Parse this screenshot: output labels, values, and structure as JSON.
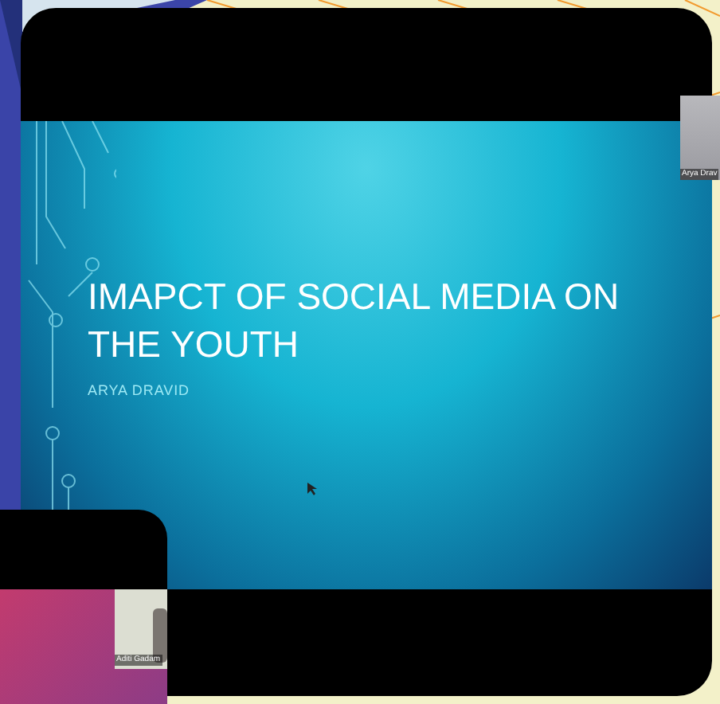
{
  "slide": {
    "title": "IMAPCT OF SOCIAL MEDIA ON THE YOUTH",
    "subtitle": "ARYA DRAVID"
  },
  "participants": [
    {
      "name": "Arya Drav"
    },
    {
      "name": "Aditi Gadam"
    }
  ]
}
